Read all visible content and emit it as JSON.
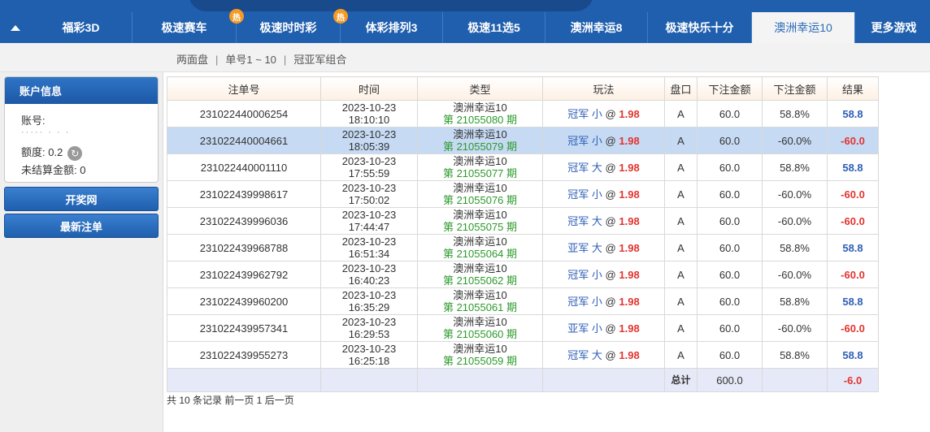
{
  "nav": {
    "tabs": [
      {
        "label": "福彩3D",
        "hot": false,
        "active": false
      },
      {
        "label": "极速赛车",
        "hot": true,
        "active": false
      },
      {
        "label": "极速时时彩",
        "hot": true,
        "active": false
      },
      {
        "label": "体彩排列3",
        "hot": false,
        "active": false
      },
      {
        "label": "极速11选5",
        "hot": false,
        "active": false
      },
      {
        "label": "澳洲幸运8",
        "hot": false,
        "active": false
      },
      {
        "label": "极速快乐十分",
        "hot": false,
        "active": false
      },
      {
        "label": "澳洲幸运10",
        "hot": false,
        "active": true
      },
      {
        "label": "更多游戏",
        "hot": false,
        "active": false
      }
    ],
    "hot_badge": "热"
  },
  "subnav": {
    "items": [
      "两面盘",
      "单号1 ~ 10",
      "冠亚军组合"
    ],
    "sep": "|"
  },
  "account": {
    "title": "账户信息",
    "account_label": "账号:",
    "quota_label": "额度: 0.2",
    "unsettled_label": "未结算金额: 0"
  },
  "sidebar_buttons": {
    "results": "开奖网",
    "latest": "最新注单"
  },
  "table": {
    "headers": [
      "注单号",
      "时间",
      "类型",
      "玩法",
      "盘口",
      "下注金额",
      "下注金额",
      "结果"
    ],
    "rows": [
      {
        "id": "231022440006254",
        "date": "2023-10-23",
        "time": "18:10:10",
        "game": "澳洲幸运10",
        "period": "第 21055080 期",
        "play": "冠军 小",
        "at": "@",
        "odds": "1.98",
        "pan": "A",
        "amount": "60.0",
        "pct": "58.8%",
        "result": "58.8",
        "neg": false,
        "sel": false
      },
      {
        "id": "231022440004661",
        "date": "2023-10-23",
        "time": "18:05:39",
        "game": "澳洲幸运10",
        "period": "第 21055079 期",
        "play": "冠军 小",
        "at": "@",
        "odds": "1.98",
        "pan": "A",
        "amount": "60.0",
        "pct": "-60.0%",
        "result": "-60.0",
        "neg": true,
        "sel": true
      },
      {
        "id": "231022440001110",
        "date": "2023-10-23",
        "time": "17:55:59",
        "game": "澳洲幸运10",
        "period": "第 21055077 期",
        "play": "冠军 大",
        "at": "@",
        "odds": "1.98",
        "pan": "A",
        "amount": "60.0",
        "pct": "58.8%",
        "result": "58.8",
        "neg": false,
        "sel": false
      },
      {
        "id": "231022439998617",
        "date": "2023-10-23",
        "time": "17:50:02",
        "game": "澳洲幸运10",
        "period": "第 21055076 期",
        "play": "冠军 小",
        "at": "@",
        "odds": "1.98",
        "pan": "A",
        "amount": "60.0",
        "pct": "-60.0%",
        "result": "-60.0",
        "neg": true,
        "sel": false
      },
      {
        "id": "231022439996036",
        "date": "2023-10-23",
        "time": "17:44:47",
        "game": "澳洲幸运10",
        "period": "第 21055075 期",
        "play": "冠军 大",
        "at": "@",
        "odds": "1.98",
        "pan": "A",
        "amount": "60.0",
        "pct": "-60.0%",
        "result": "-60.0",
        "neg": true,
        "sel": false
      },
      {
        "id": "231022439968788",
        "date": "2023-10-23",
        "time": "16:51:34",
        "game": "澳洲幸运10",
        "period": "第 21055064 期",
        "play": "亚军 大",
        "at": "@",
        "odds": "1.98",
        "pan": "A",
        "amount": "60.0",
        "pct": "58.8%",
        "result": "58.8",
        "neg": false,
        "sel": false
      },
      {
        "id": "231022439962792",
        "date": "2023-10-23",
        "time": "16:40:23",
        "game": "澳洲幸运10",
        "period": "第 21055062 期",
        "play": "冠军 小",
        "at": "@",
        "odds": "1.98",
        "pan": "A",
        "amount": "60.0",
        "pct": "-60.0%",
        "result": "-60.0",
        "neg": true,
        "sel": false
      },
      {
        "id": "231022439960200",
        "date": "2023-10-23",
        "time": "16:35:29",
        "game": "澳洲幸运10",
        "period": "第 21055061 期",
        "play": "冠军 小",
        "at": "@",
        "odds": "1.98",
        "pan": "A",
        "amount": "60.0",
        "pct": "58.8%",
        "result": "58.8",
        "neg": false,
        "sel": false
      },
      {
        "id": "231022439957341",
        "date": "2023-10-23",
        "time": "16:29:53",
        "game": "澳洲幸运10",
        "period": "第 21055060 期",
        "play": "亚军 小",
        "at": "@",
        "odds": "1.98",
        "pan": "A",
        "amount": "60.0",
        "pct": "-60.0%",
        "result": "-60.0",
        "neg": true,
        "sel": false
      },
      {
        "id": "231022439955273",
        "date": "2023-10-23",
        "time": "16:25:18",
        "game": "澳洲幸运10",
        "period": "第 21055059 期",
        "play": "冠军 大",
        "at": "@",
        "odds": "1.98",
        "pan": "A",
        "amount": "60.0",
        "pct": "58.8%",
        "result": "58.8",
        "neg": false,
        "sel": false
      }
    ],
    "total": {
      "label": "总计",
      "amount": "600.0",
      "result": "-6.0"
    }
  },
  "footer": "共 10 条记录 前一页 1 后一页",
  "colors": {
    "nav": "#1f5fae",
    "positive": "#2f5fb8",
    "negative": "#e3342f",
    "period": "#2c9a2c"
  }
}
